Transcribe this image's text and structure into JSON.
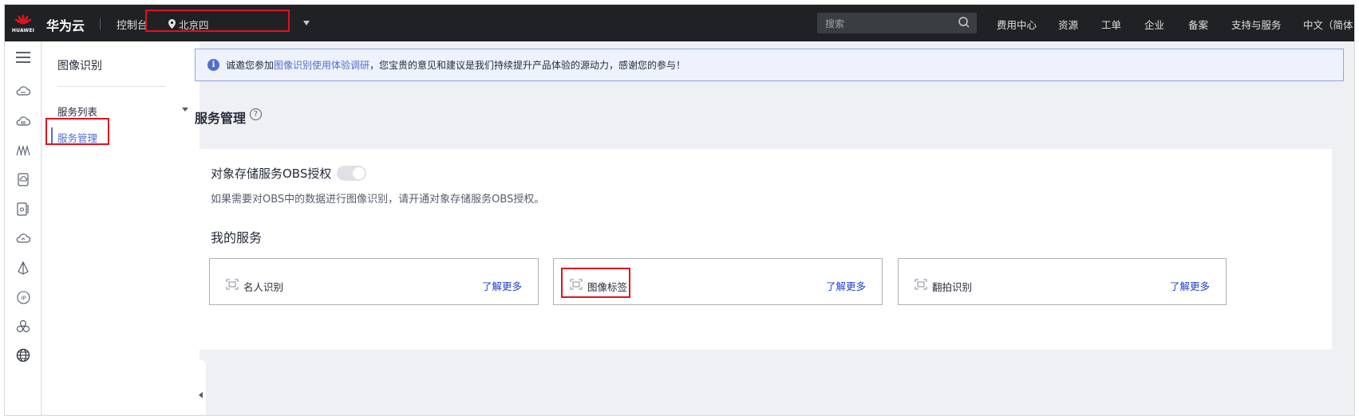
{
  "topbar": {
    "logo_text": "HUAWEI",
    "brand": "华为云",
    "console": "控制台",
    "region": "北京四",
    "search_placeholder": "搜索",
    "nav": [
      "费用中心",
      "资源",
      "工单",
      "企业",
      "备案",
      "支持与服务",
      "中文（简体"
    ]
  },
  "rail": {
    "icons": [
      "menu-icon",
      "cloud-server-icon",
      "cloud-database-icon",
      "network-icon",
      "storage-icon",
      "container-icon",
      "cloud-icon",
      "ai-icon",
      "ip-icon",
      "cluster-icon",
      "global-icon"
    ]
  },
  "sidebar": {
    "title": "图像识别",
    "group": "服务列表",
    "active_item": "服务管理"
  },
  "notice": {
    "prefix": "诚邀您参加",
    "link": "图像识别使用体验调研",
    "suffix": "，您宝贵的意见和建议是我们持续提升产品体验的源动力，感谢您的参与！"
  },
  "main": {
    "title": "服务管理",
    "help": "?",
    "obs_label": "对象存储服务OBS授权",
    "obs_enabled": false,
    "obs_desc": "如果需要对OBS中的数据进行图像识别，请开通对象存储服务OBS授权。",
    "my_services": "我的服务",
    "cards": [
      {
        "name": "名人识别",
        "more": "了解更多"
      },
      {
        "name": "图像标签",
        "more": "了解更多"
      },
      {
        "name": "翻拍识别",
        "more": "了解更多"
      }
    ]
  },
  "colors": {
    "topbar_bg": "#1f2124",
    "accent": "#526ecc",
    "link": "#1f3fd1",
    "highlight": "#e1121c"
  }
}
